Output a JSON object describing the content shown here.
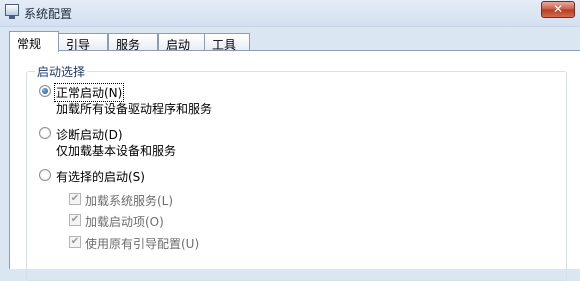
{
  "window": {
    "title": "系统配置",
    "close_glyph": "✕"
  },
  "tabs": [
    {
      "label": "常规",
      "active": true
    },
    {
      "label": "引导",
      "active": false
    },
    {
      "label": "服务",
      "active": false
    },
    {
      "label": "启动",
      "active": false
    },
    {
      "label": "工具",
      "active": false
    }
  ],
  "startup_group": {
    "legend": "启动选择",
    "options": [
      {
        "label": "正常启动(N)",
        "description": "加载所有设备驱动程序和服务",
        "checked": true
      },
      {
        "label": "诊断启动(D)",
        "description": "仅加载基本设备和服务",
        "checked": false
      },
      {
        "label": "有选择的启动(S)",
        "checked": false
      }
    ],
    "sub_options": [
      {
        "label": "加载系统服务(L)",
        "checked": true,
        "enabled": false
      },
      {
        "label": "加载启动项(O)",
        "checked": true,
        "enabled": false
      },
      {
        "label": "使用原有引导配置(U)",
        "checked": true,
        "enabled": false
      }
    ]
  },
  "icons": {
    "app": "msconfig-icon",
    "check": "✔"
  },
  "colors": {
    "titlebar": "#d3e0f0",
    "close_button": "#c85a45",
    "group_border": "#d5dfe5",
    "disabled_text": "#6d6d6d"
  }
}
